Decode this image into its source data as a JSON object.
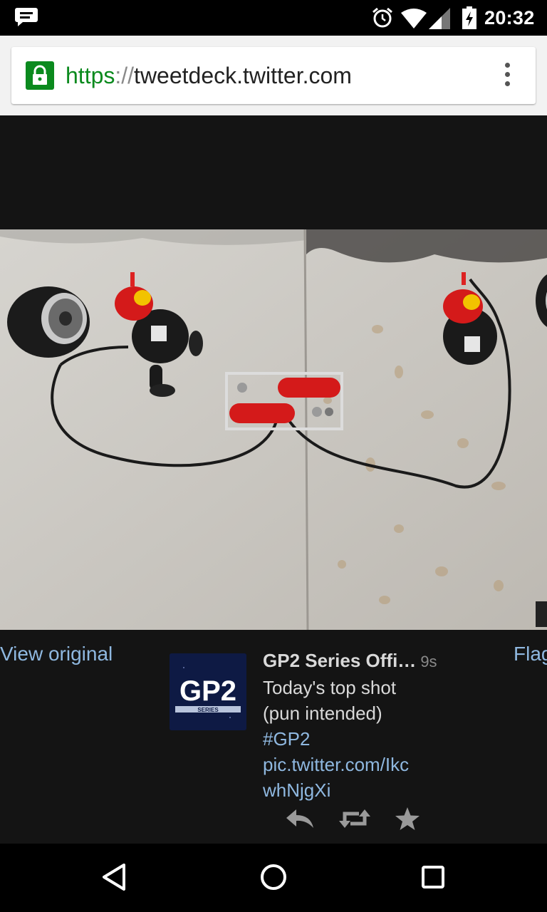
{
  "status_bar": {
    "time": "20:32",
    "icons": [
      "message-icon",
      "alarm-icon",
      "wifi-icon",
      "signal-icon",
      "battery-charging-icon"
    ]
  },
  "browser": {
    "url_scheme": "https",
    "url_separator": "://",
    "url_host": "tweetdeck.twitter.com",
    "secure_color": "#0b8a1e"
  },
  "media_viewer": {
    "view_original_label": "View original",
    "flag_label": "Flag"
  },
  "tweet": {
    "author": "GP2 Series Offi…",
    "timestamp": "9s",
    "text_line1": "Today's top shot",
    "text_line2": "(pun intended)",
    "hashtag": "#GP2",
    "link_line1": "pic.twitter.com/Ikc",
    "link_line2": "whNjgXi",
    "avatar_text": "GP2",
    "avatar_subtext": "SERIES",
    "actions": [
      "reply-icon",
      "retweet-icon",
      "favorite-icon"
    ]
  },
  "nav_bar": {
    "buttons": [
      "back-icon",
      "home-icon",
      "recents-icon"
    ]
  },
  "colors": {
    "link": "#8fb8e0",
    "background": "#141414"
  }
}
